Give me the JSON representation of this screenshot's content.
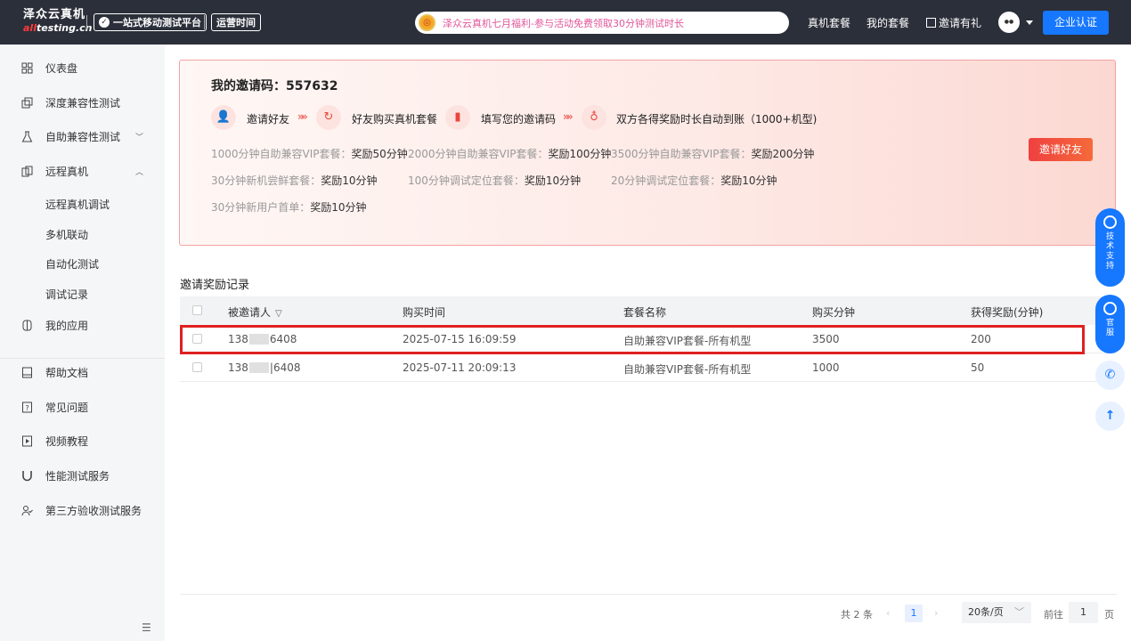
{
  "header": {
    "brand_name": "泽众云真机",
    "brand_domain_a": "all",
    "brand_domain_b": "testing.cn",
    "platform_tag": "一站式移动测试平台",
    "hours_tag": "运营时间",
    "announcement": "泽众云真机七月福利-参与活动免费领取30分钟测试时长",
    "nav": [
      "真机套餐",
      "我的套餐",
      "邀请有礼"
    ],
    "enterprise_button": "企业认证"
  },
  "sidebar": {
    "items": [
      {
        "label": "仪表盘",
        "icon": "dashboard-icon"
      },
      {
        "label": "深度兼容性测试",
        "icon": "layers-icon"
      },
      {
        "label": "自助兼容性测试",
        "icon": "flask-icon",
        "arrow": "down"
      },
      {
        "label": "远程真机",
        "icon": "device-icon",
        "arrow": "up"
      },
      {
        "label": "我的应用",
        "icon": "app-icon"
      },
      {
        "label": "帮助文档",
        "icon": "book-icon"
      },
      {
        "label": "常见问题",
        "icon": "question-icon"
      },
      {
        "label": "视频教程",
        "icon": "video-icon"
      },
      {
        "label": "性能测试服务",
        "icon": "magnet-icon"
      },
      {
        "label": "第三方验收测试服务",
        "icon": "user-check-icon"
      }
    ],
    "subitems": [
      "远程真机调试",
      "多机联动",
      "自动化测试",
      "调试记录"
    ]
  },
  "banner": {
    "code_label": "我的邀请码：",
    "code_value": "557632",
    "steps": [
      "邀请好友",
      "好友购买真机套餐",
      "填写您的邀请码",
      "双方各得奖励时长自动到账（1000+机型)"
    ],
    "rewards": [
      {
        "pkg": "1000分钟自助兼容VIP套餐：",
        "val": "奖励50分钟"
      },
      {
        "pkg": "2000分钟自助兼容VIP套餐：",
        "val": "奖励100分钟"
      },
      {
        "pkg": "3500分钟自助兼容VIP套餐：",
        "val": "奖励200分钟"
      },
      {
        "pkg": "30分钟新机尝鲜套餐：",
        "val": "奖励10分钟"
      },
      {
        "pkg": "100分钟调试定位套餐：",
        "val": "奖励10分钟"
      },
      {
        "pkg": "20分钟调试定位套餐：",
        "val": "奖励10分钟"
      },
      {
        "pkg": "30分钟新用户首单：",
        "val": "奖励10分钟"
      }
    ],
    "invite_button": "邀请好友"
  },
  "records": {
    "title": "邀请奖励记录",
    "columns": [
      "被邀请人",
      "购买时间",
      "套餐名称",
      "购买分钟",
      "获得奖励(分钟)"
    ],
    "rows": [
      {
        "phone_a": "138",
        "phone_b": "6408",
        "time": "2025-07-15 16:09:59",
        "pkg": "自助兼容VIP套餐-所有机型",
        "minutes": "3500",
        "reward": "200"
      },
      {
        "phone_a": "138",
        "phone_b": "|6408",
        "time": "2025-07-11 20:09:13",
        "pkg": "自助兼容VIP套餐-所有机型",
        "minutes": "1000",
        "reward": "50"
      }
    ]
  },
  "pagination": {
    "total": "共 2 条",
    "current": "1",
    "page_size": "20条/页",
    "goto_label": "前往",
    "goto_value": "1",
    "page_unit": "页"
  },
  "float": {
    "tech_support": "技术支持",
    "official": "官服"
  }
}
